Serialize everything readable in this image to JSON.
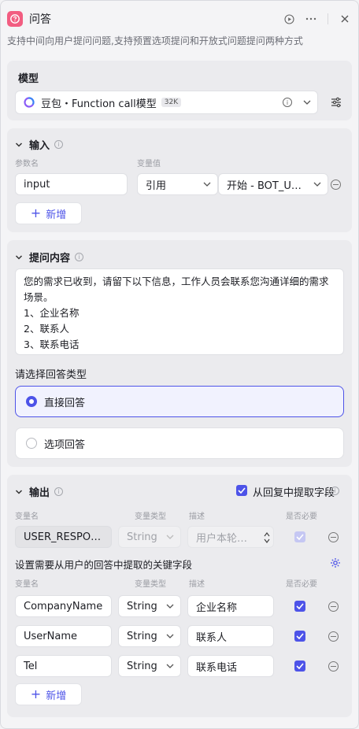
{
  "header": {
    "title": "问答",
    "description": "支持中间向用户提问问题,支持预置选项提问和开放式问题提问两种方式"
  },
  "model": {
    "section_title": "模型",
    "name": "豆包・Function call模型",
    "badge": "32K"
  },
  "input": {
    "section_title": "输入",
    "col_param": "参数名",
    "col_value": "变量值",
    "row": {
      "name": "input",
      "ref_type": "引用",
      "ref_value": "开始 - BOT_USER_INPUT"
    },
    "add_label": "新增"
  },
  "question": {
    "section_title": "提问内容",
    "lines": [
      "您的需求已收到，请留下以下信息，工作人员会联系您沟通详细的需求",
      "场景。",
      "1、企业名称",
      "2、联系人",
      "3、联系电话"
    ],
    "answer_type_label": "请选择回答类型",
    "options": [
      {
        "label": "直接回答",
        "selected": true
      },
      {
        "label": "选项回答",
        "selected": false
      }
    ]
  },
  "output": {
    "section_title": "输出",
    "extract_label": "从回复中提取字段",
    "col_name": "变量名",
    "col_type": "变量类型",
    "col_desc": "描述",
    "col_required": "是否必要",
    "fixed_row": {
      "name": "USER_RESPONSE",
      "type": "String",
      "desc": "用户本轮对话输入内容"
    },
    "extract_hint": "设置需要从用户的回答中提取的关键字段",
    "rows": [
      {
        "name": "CompanyName",
        "type": "String",
        "desc": "企业名称"
      },
      {
        "name": "UserName",
        "type": "String",
        "desc": "联系人"
      },
      {
        "name": "Tel",
        "type": "String",
        "desc": "联系电话"
      }
    ],
    "add_label": "新增"
  },
  "colors": {
    "accent": "#4d53e8",
    "node_icon": "#f25d81"
  }
}
